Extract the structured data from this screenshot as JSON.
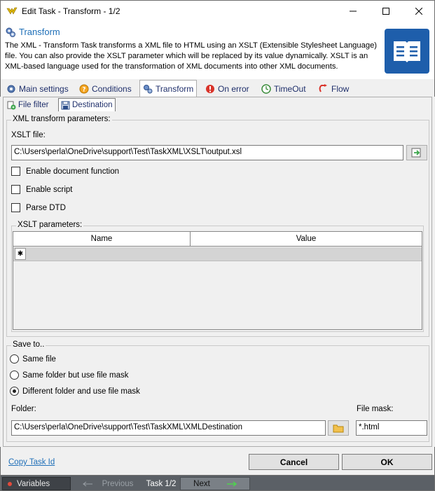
{
  "window": {
    "title": "Edit Task - Transform - 1/2"
  },
  "header": {
    "title": "Transform",
    "description": "The XML - Transform Task transforms a XML file to HTML using an XSLT (Extensible Stylesheet Language) file. You can also provide the XSLT parameter which will be replaced by its value dynamically. XSLT is an XML-based language used for the transformation of XML documents into other XML documents."
  },
  "tabs": [
    {
      "label": "Main settings",
      "icon": "gear-icon"
    },
    {
      "label": "Conditions",
      "icon": "question-icon"
    },
    {
      "label": "Transform",
      "icon": "transform-icon",
      "active": true
    },
    {
      "label": "On error",
      "icon": "error-icon"
    },
    {
      "label": "TimeOut",
      "icon": "timeout-icon"
    },
    {
      "label": "Flow",
      "icon": "flow-icon"
    }
  ],
  "subtabs": [
    {
      "label": "File filter",
      "icon": "file-filter-icon"
    },
    {
      "label": "Destination",
      "icon": "destination-icon",
      "active": true
    }
  ],
  "xml_params": {
    "legend": "XML transform parameters:",
    "xslt_label": "XSLT file:",
    "xslt_value": "C:\\Users\\perla\\OneDrive\\support\\Test\\TaskXML\\XSLT\\output.xsl",
    "checks": [
      {
        "label": "Enable document function",
        "checked": false
      },
      {
        "label": "Enable script",
        "checked": false
      },
      {
        "label": "Parse DTD",
        "checked": false
      }
    ],
    "xslt_params_legend": "XSLT parameters:",
    "columns": [
      "Name",
      "Value"
    ],
    "new_row_marker": "✱"
  },
  "save_to": {
    "legend": "Save to..",
    "options": [
      {
        "label": "Same file",
        "selected": false
      },
      {
        "label": "Same folder but use file mask",
        "selected": false
      },
      {
        "label": "Different folder and use file mask",
        "selected": true
      }
    ],
    "folder_label": "Folder:",
    "folder_value": "C:\\Users\\perla\\OneDrive\\support\\Test\\TaskXML\\XMLDestination",
    "mask_label": "File mask:",
    "mask_value": "*.html"
  },
  "footer": {
    "copy_link": "Copy Task Id",
    "cancel": "Cancel",
    "ok": "OK"
  },
  "statusbar": {
    "variables": "Variables",
    "previous": "Previous",
    "task": "Task 1/2",
    "next": "Next"
  },
  "colors": {
    "accent": "#1e6fb8",
    "statusbar": "#5b6066",
    "book": "#1e5eab"
  }
}
